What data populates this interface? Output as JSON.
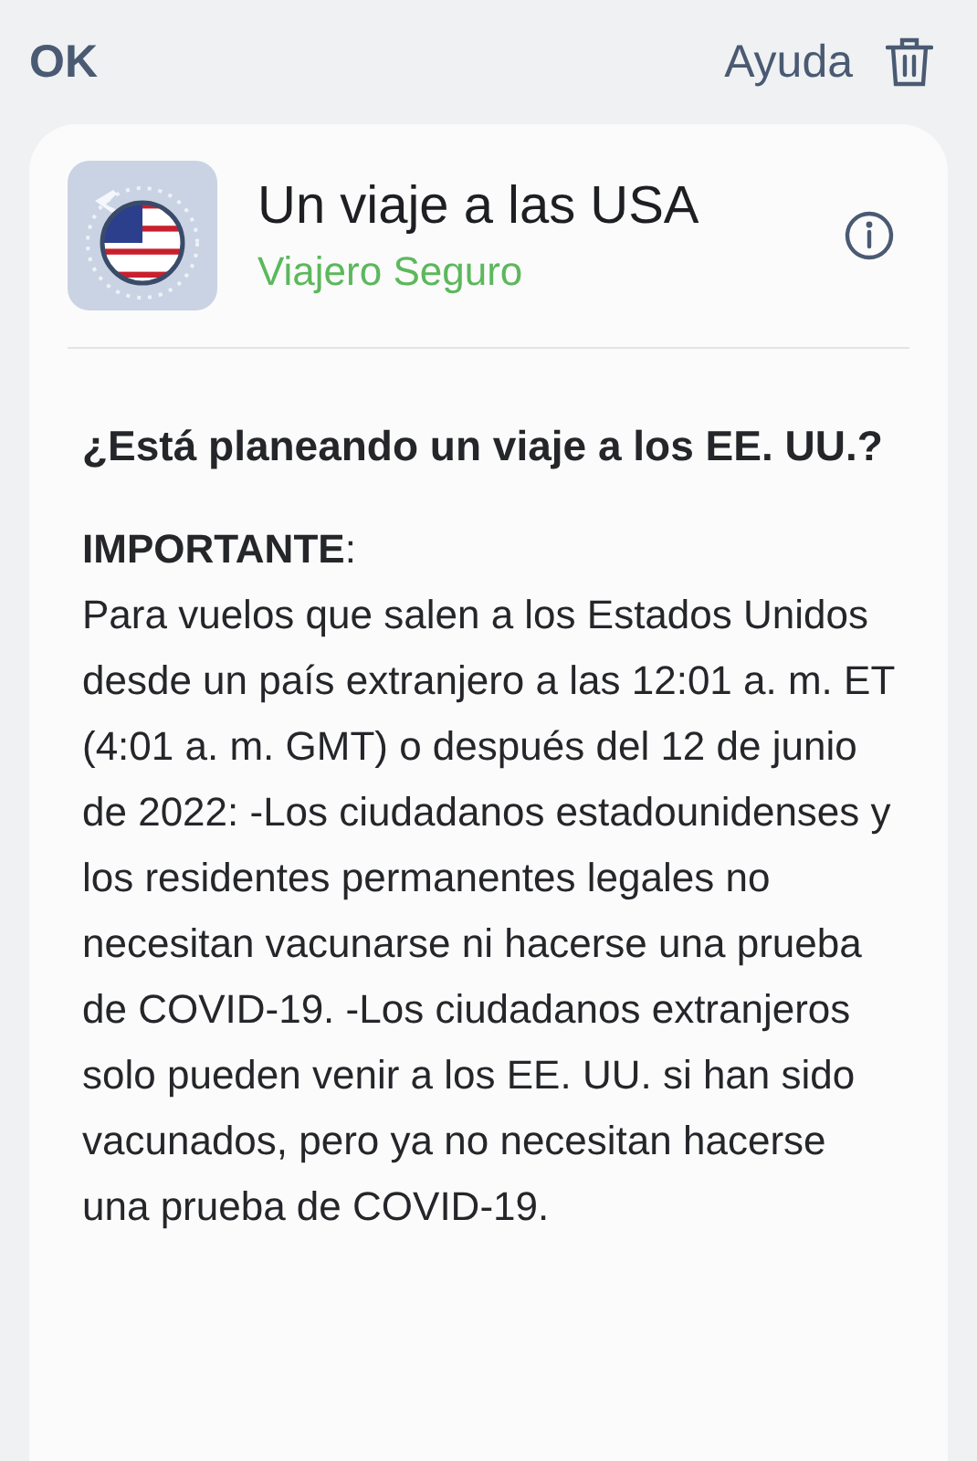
{
  "nav": {
    "ok": "OK",
    "help": "Ayuda"
  },
  "card": {
    "title": "Un viaje a las USA",
    "subtitle": "Viajero Seguro",
    "question": "¿Está planeando un viaje a los EE. UU.?",
    "body": "**IMPORTANTE**:\nPara vuelos que salen a los Estados Unidos desde un país extranjero a las 12:01 a. m. ET (4:01 a. m. GMT) o después del 12 de junio de 2022: -Los ciudadanos estadounidenses y los residentes permanentes legales no necesitan vacunarse ni hacerse una prueba de COVID-19. -Los ciudadanos extranjeros solo pueden venir a los EE. UU. si han sido vacunados, pero ya no necesitan hacerse una prueba de COVID-19."
  }
}
